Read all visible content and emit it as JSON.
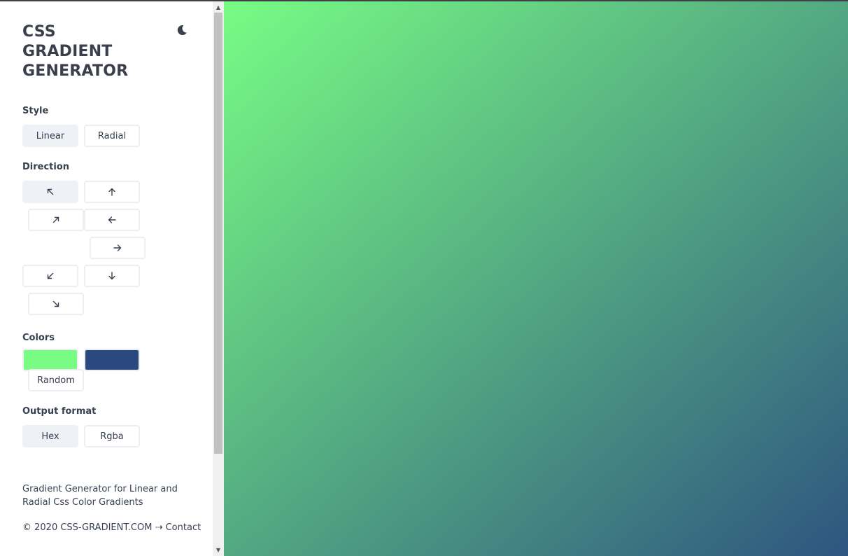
{
  "app": {
    "title_lines": [
      "CSS",
      "GRADIENT",
      "GENERATOR"
    ],
    "theme_toggle_icon": "moon-icon"
  },
  "style": {
    "label": "Style",
    "options": [
      "Linear",
      "Radial"
    ],
    "selected": "Linear"
  },
  "direction": {
    "label": "Direction",
    "options": [
      {
        "name": "top-left",
        "icon": "arrow-up-left-icon"
      },
      {
        "name": "top",
        "icon": "arrow-up-icon"
      },
      {
        "name": "top-right",
        "icon": "arrow-up-right-icon"
      },
      {
        "name": "left",
        "icon": "arrow-left-icon"
      },
      {
        "name": "right",
        "icon": "arrow-right-icon"
      },
      {
        "name": "bottom-left",
        "icon": "arrow-down-left-icon"
      },
      {
        "name": "bottom",
        "icon": "arrow-down-icon"
      },
      {
        "name": "bottom-right",
        "icon": "arrow-down-right-icon"
      }
    ],
    "selected": "top-left"
  },
  "colors": {
    "label": "Colors",
    "stops": [
      "#78fc84",
      "#2a4a7f"
    ],
    "random_label": "Random"
  },
  "output": {
    "label": "Output format",
    "options": [
      "Hex",
      "Rgba"
    ],
    "selected": "Hex"
  },
  "preview": {
    "from": "#78fc84",
    "to": "#2e5580",
    "direction": "to bottom right"
  },
  "description": "Gradient Generator for Linear and Radial Css Color Gradients",
  "footer": {
    "copyright": "© 2020 CSS-GRADIENT.COM",
    "separator": "⇢",
    "contact": "Contact"
  }
}
